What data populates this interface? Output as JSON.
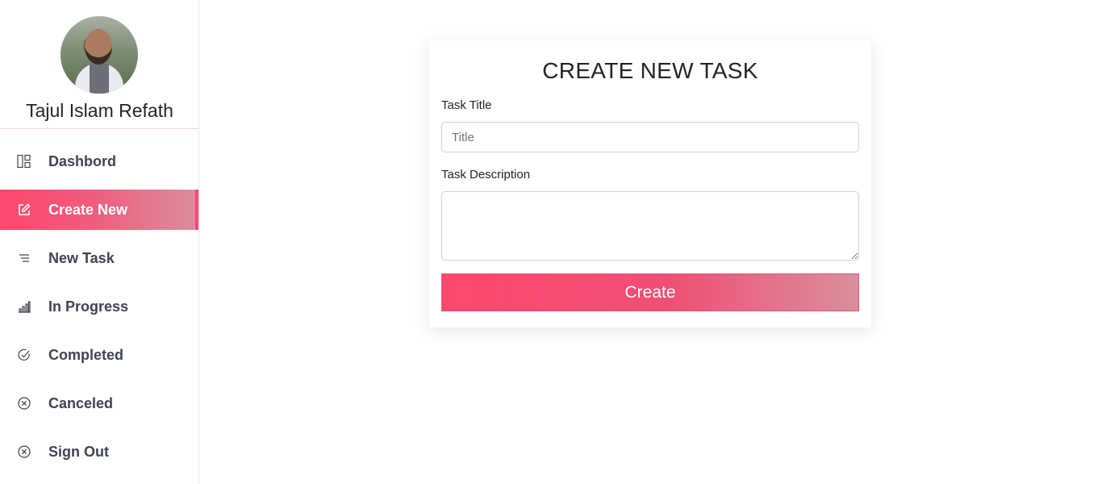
{
  "profile": {
    "name": "Tajul Islam Refath"
  },
  "sidebar": {
    "items": [
      {
        "label": "Dashbord",
        "icon": "dashboard-icon",
        "active": false
      },
      {
        "label": "Create New",
        "icon": "edit-icon",
        "active": true
      },
      {
        "label": "New Task",
        "icon": "list-icon",
        "active": false
      },
      {
        "label": "In Progress",
        "icon": "bar-chart-icon",
        "active": false
      },
      {
        "label": "Completed",
        "icon": "check-circle-icon",
        "active": false
      },
      {
        "label": "Canceled",
        "icon": "x-circle-icon",
        "active": false
      },
      {
        "label": "Sign Out",
        "icon": "x-circle-icon",
        "active": false
      }
    ]
  },
  "form": {
    "title": "CREATE NEW TASK",
    "task_title_label": "Task Title",
    "task_title_placeholder": "Title",
    "task_title_value": "",
    "task_description_label": "Task Description",
    "task_description_value": "",
    "submit_label": "Create"
  },
  "colors": {
    "accent": "#ff476f",
    "accent_end": "#d98f9c",
    "nav_text": "#3d4452"
  }
}
